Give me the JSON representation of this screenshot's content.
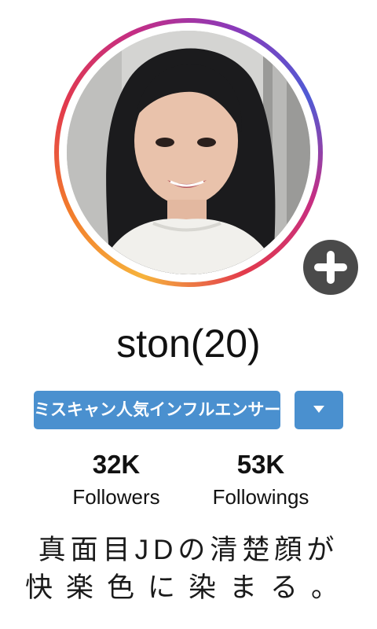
{
  "profile": {
    "username": "ston(20)",
    "avatar_icon": "profile-photo",
    "add_icon": "plus-icon",
    "ring_colors": [
      "#f6b33c",
      "#e23a4c",
      "#c52e84",
      "#4f5bd5"
    ]
  },
  "tag_button": {
    "label": "ミスキャン人気インフルエンサー",
    "dropdown_icon": "caret-down-icon",
    "color": "#4a90cf"
  },
  "stats": {
    "followers_value": "32K",
    "followers_label": "Followers",
    "followings_value": "53K",
    "followings_label": "Followings"
  },
  "tagline": {
    "line1": "真面目JDの清楚顔が",
    "line2": "快楽色に染まる。"
  }
}
